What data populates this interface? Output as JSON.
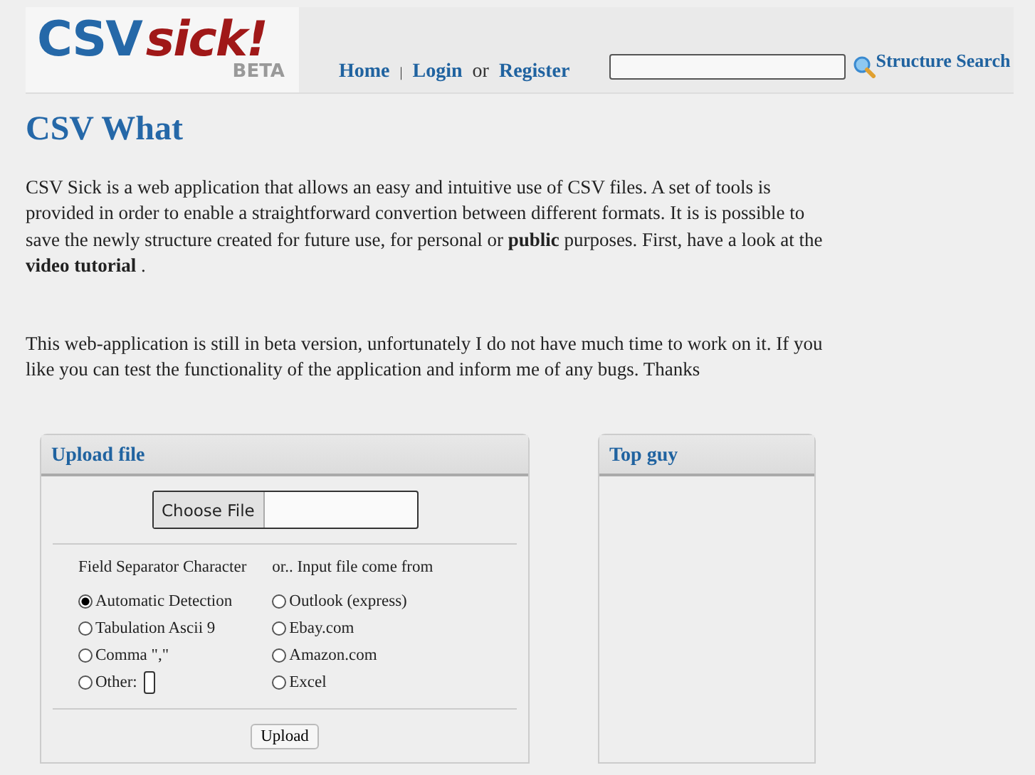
{
  "logo": {
    "part_1": "CSV",
    "part_2": "sick!",
    "badge": "BETA"
  },
  "nav": [
    {
      "label": "Home",
      "kind": "link"
    },
    {
      "label": "|",
      "kind": "separator"
    },
    {
      "label": "Login",
      "kind": "link"
    },
    {
      "label": "or",
      "kind": "text"
    },
    {
      "label": "Register",
      "kind": "link"
    }
  ],
  "search": {
    "button": "Structure Search"
  },
  "title": "CSV What",
  "paragraphs": [
    "CSV Sick is a web application that allows an easy and intuitive use of CSV files. A set of tools is provided in order to enable a straightforward convertion between different formats. It is is possible to save the newly structure created for future use, for personal or **public** purposes. First, have a look at the **video tutorial** .",
    "This web-application is still in beta version, unfortunately I do not have much time to work on it. If you like you can test the functionality of the application and inform me of any bugs. Thanks"
  ],
  "upload_panel": {
    "title": "Upload file",
    "file_button": "Choose File",
    "separator_group": {
      "heading": "Field Separator Character",
      "options": [
        {
          "label": "Automatic Detection",
          "selected": true
        },
        {
          "label": "Tabulation Ascii 9",
          "selected": false
        },
        {
          "label": "Comma \",\"",
          "selected": false
        },
        {
          "label": "Other:",
          "selected": false,
          "kind": "input"
        }
      ]
    },
    "source_group": {
      "heading": "or.. Input file come from",
      "options": [
        {
          "label": "Outlook (express)",
          "selected": false
        },
        {
          "label": "Ebay.com",
          "selected": false
        },
        {
          "label": "Amazon.com",
          "selected": false
        },
        {
          "label": "Excel",
          "selected": false
        }
      ]
    },
    "submit": "Upload"
  },
  "side_panel": {
    "title": "Top guy"
  }
}
